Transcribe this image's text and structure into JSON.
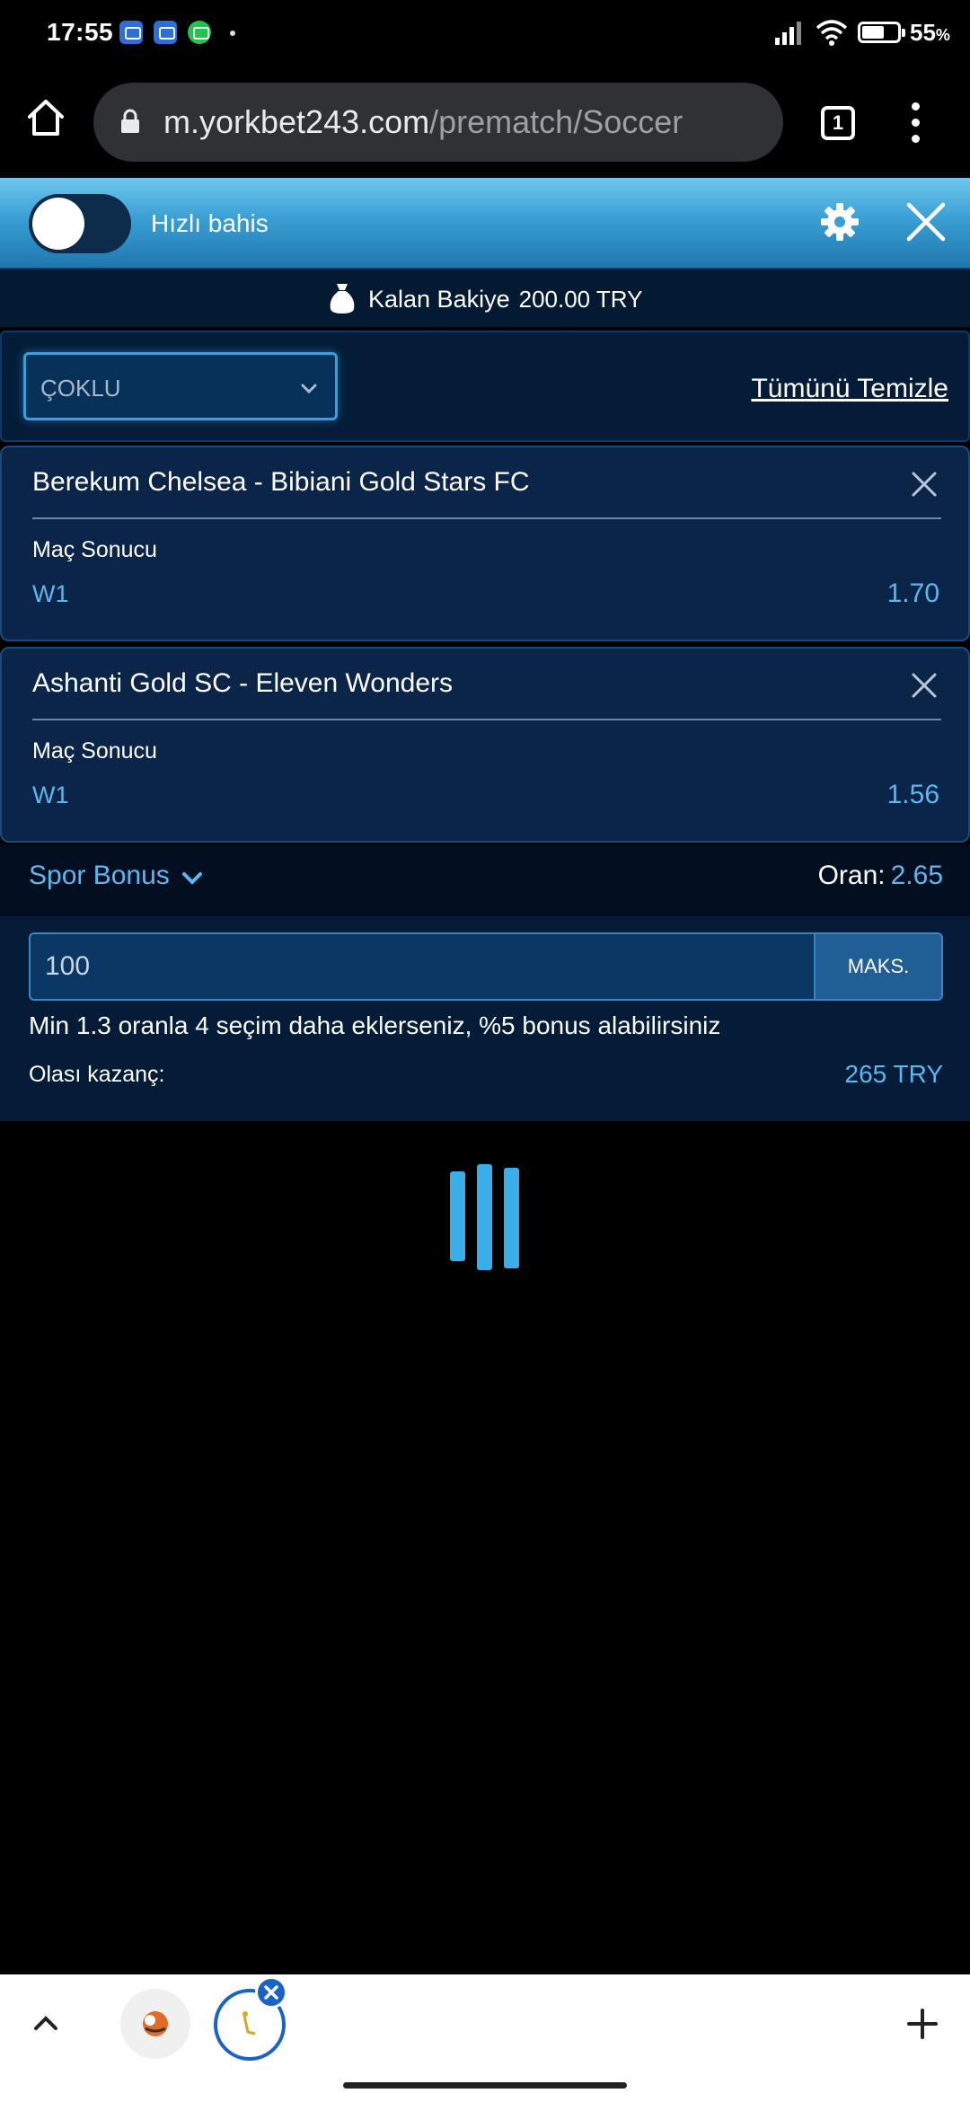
{
  "status_bar": {
    "time": "17:55",
    "battery_percent": "55",
    "battery_unit": "%"
  },
  "browser": {
    "url_host": "m.yorkbet243.com",
    "url_path": "/prematch/Soccer",
    "tab_count": "1"
  },
  "header": {
    "quick_bet_label": "Hızlı bahis",
    "quick_bet_enabled": false
  },
  "balance": {
    "label": "Kalan Bakiye",
    "amount": "200.00 TRY"
  },
  "bet_type": {
    "selected": "ÇOKLU",
    "clear_all": "Tümünü Temizle"
  },
  "bets": [
    {
      "match": "Berekum Chelsea - Bibiani Gold Stars FC",
      "market": "Maç Sonucu",
      "selection": "W1",
      "odds": "1.70"
    },
    {
      "match": "Ashanti Gold SC - Eleven Wonders",
      "market": "Maç Sonucu",
      "selection": "W1",
      "odds": "1.56"
    }
  ],
  "summary": {
    "bonus_label": "Spor Bonus",
    "odds_label": "Oran:",
    "odds_value": "2.65",
    "stake_value": "100",
    "max_label": "MAKS.",
    "bonus_hint": "Min 1.3 oranla 4 seçim daha eklerseniz, %5 bonus alabilirsiniz",
    "possible_win_label": "Olası kazanç:",
    "possible_win_value": "265 TRY"
  },
  "colors": {
    "accent": "#5bb7ef",
    "header_gradient_top": "#6fc6ee",
    "header_gradient_bottom": "#1f77ad",
    "panel_bg": "#041c38",
    "card_bg": "#0b2548",
    "loader": "#3aaee9"
  },
  "icons": [
    "home-icon",
    "lock-icon",
    "tabs-icon",
    "more-vert-icon",
    "gear-icon",
    "close-icon",
    "money-bag-icon",
    "chevron-down-icon",
    "remove-icon",
    "loader-icon",
    "chevron-up-icon",
    "plus-icon"
  ]
}
